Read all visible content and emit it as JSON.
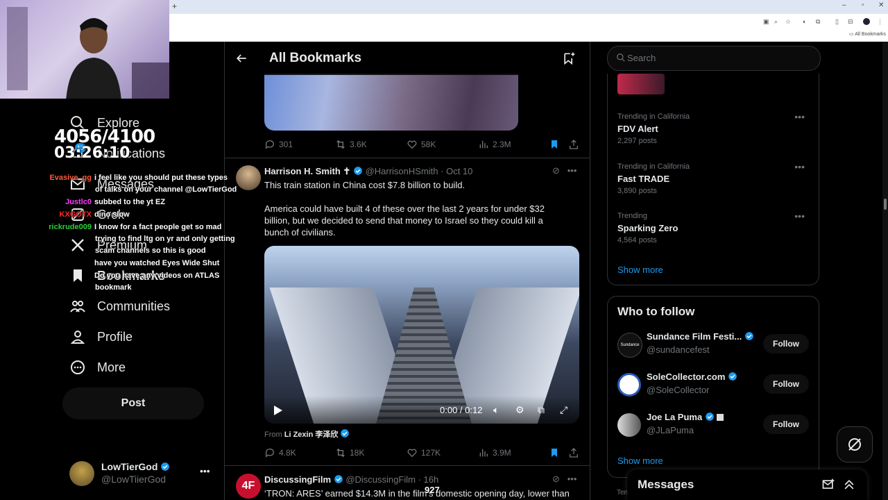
{
  "stream": {
    "stat_top": "4056/4100",
    "stat_timer": "03:26:10",
    "overlay_count": "927"
  },
  "chat": [
    {
      "user": "Evasive_gg",
      "color": "#ff5a3a",
      "msg": "i feel like you should put these types",
      "cont": "of talks on your channel @LowTierGod"
    },
    {
      "user": "Justlc0",
      "color": "#ff3aff",
      "msg": "subbed to the yt EZ"
    },
    {
      "user": "KXGOTX",
      "color": "#ff2a2a",
      "msg": "dino slow"
    },
    {
      "user": "rickrude009",
      "color": "#2ad13a",
      "msg": "I know for a fact people get so mad",
      "cont": "trying to find ltg on yr and only getting",
      "cont2": "scam channels so this is good"
    },
    {
      "user": "",
      "color": "#6a3aff",
      "msg": "have you watched Eyes Wide Shut"
    },
    {
      "user": "",
      "color": "#4a3aff",
      "msg": "Do you have any videos on ATLAS",
      "cont": "bookmark"
    }
  ],
  "nav": {
    "items": [
      {
        "label": "Explore",
        "icon": "search-icon"
      },
      {
        "label": "Notifications",
        "icon": "bell-icon",
        "badge": "13"
      },
      {
        "label": "Messages",
        "icon": "mail-icon"
      },
      {
        "label": "Grok",
        "icon": "grok-icon"
      },
      {
        "label": "Premium",
        "icon": "x-icon"
      },
      {
        "label": "Bookmarks",
        "icon": "bookmark-icon"
      },
      {
        "label": "Communities",
        "icon": "people-icon"
      },
      {
        "label": "Profile",
        "icon": "person-icon"
      },
      {
        "label": "More",
        "icon": "more-circle-icon"
      }
    ],
    "post_label": "Post",
    "account": {
      "name": "LowTierGod",
      "handle": "@LowTiierGod"
    }
  },
  "main": {
    "title": "All Bookmarks",
    "tweets": [
      {
        "replies": "301",
        "reposts": "3.6K",
        "likes": "58K",
        "views": "2.3M"
      },
      {
        "name": "Harrison H. Smith ✝",
        "handle": "@HarrisonHSmith",
        "time": "· Oct 10",
        "text1": "This train station in China cost $7.8 billion to build.",
        "text2": "America could have built 4 of these over the last 2 years for under $32 billion, but we decided to send that money to Israel so they could kill a bunch of civilians.",
        "video_time": "0:00 / 0:12",
        "from_prefix": "From",
        "from_name": "Li Zexin 李泽欣",
        "replies": "4.8K",
        "reposts": "18K",
        "likes": "127K",
        "views": "3.9M"
      },
      {
        "name": "DiscussingFilm",
        "handle": "@DiscussingFilm",
        "time": "· 16h",
        "text1": "‘TRON: ARES’ earned $14.3M in the film’s domestic opening day, lower than"
      }
    ]
  },
  "sidebar": {
    "search_placeholder": "Search",
    "trends": [
      {
        "context": "Trending in California",
        "title": "FDV Alert",
        "count": "2,297 posts"
      },
      {
        "context": "Trending in California",
        "title": "Fast TRADE",
        "count": "3,890 posts"
      },
      {
        "context": "Trending",
        "title": "Sparking Zero",
        "count": "4,564 posts"
      }
    ],
    "show_more": "Show more",
    "who_to_follow_title": "Who to follow",
    "follow": [
      {
        "name": "Sundance Film Festi...",
        "handle": "@sundancefest"
      },
      {
        "name": "SoleCollector.com",
        "handle": "@SoleCollector"
      },
      {
        "name": "Joe La Puma",
        "handle": "@JLaPuma"
      }
    ],
    "follow_label": "Follow",
    "show_more_2": "Show more",
    "terms_stub": "Terr"
  },
  "messages_drawer": {
    "title": "Messages"
  },
  "browser": {
    "bookmark_folder": "All Bookmarks"
  },
  "colors": {
    "accent": "#1d9bf0",
    "bg": "#000000",
    "border": "#2f3336",
    "muted": "#71767b"
  }
}
